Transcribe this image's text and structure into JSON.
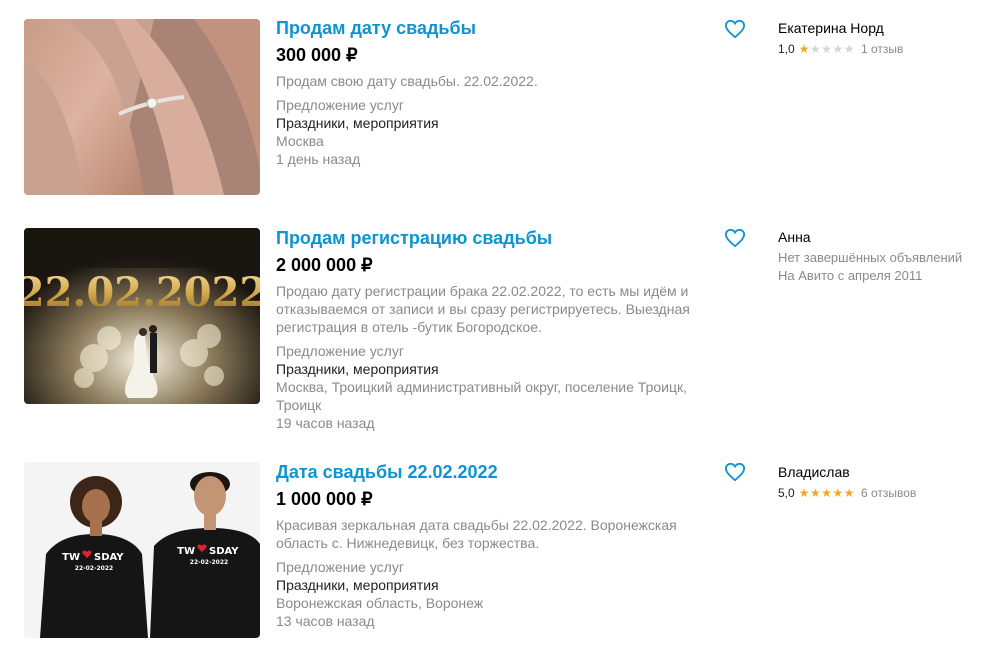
{
  "listings": [
    {
      "title": "Продам дату свадьбы",
      "price": "300 000 ₽",
      "description": "Продам свою дату свадьбы. 22.02.2022.",
      "category_type": "Предложение услуг",
      "category": "Праздники, мероприятия",
      "location": "Москва",
      "time": "1 день назад",
      "seller": {
        "name": "Екатерина Норд",
        "rating": "1,0",
        "stars": 1,
        "reviews": "1 отзыв"
      }
    },
    {
      "title": "Продам регистрацию свадьбы",
      "price": "2 000 000 ₽",
      "description": "Продаю дату регистрации брака 22.02.2022, то есть мы идём и отказываемся от записи и вы сразу регистрируетесь. Выездная регистрация в отель -бутик Богородское.",
      "category_type": "Предложение услуг",
      "category": "Праздники, мероприятия",
      "location": "Москва, Троицкий административный округ, поселение Троицк, Троицк",
      "time": "19 часов назад",
      "seller": {
        "name": "Анна",
        "line1": "Нет завершённых объявлений",
        "line2": "На Авито с апреля 2011"
      },
      "image_text": "22.02.2022"
    },
    {
      "title": "Дата свадьбы 22.02.2022",
      "price": "1 000 000 ₽",
      "description": "Красивая зеркальная дата свадьбы 22.02.2022. Воронежская область с. Нижнедевицк, без торжества.",
      "category_type": "Предложение услуг",
      "category": "Праздники, мероприятия",
      "location": "Воронежская область, Воронеж",
      "time": "13 часов назад",
      "seller": {
        "name": "Владислав",
        "rating": "5,0",
        "stars": 5,
        "reviews": "6 отзывов"
      },
      "image_text": {
        "left": "TW",
        "right": "SDAY",
        "date": "22-02-2022"
      }
    }
  ],
  "colors": {
    "link": "#0e94d0",
    "star": "#f5a623",
    "star_empty": "#d6d6d6",
    "muted": "#8a8a8a"
  }
}
